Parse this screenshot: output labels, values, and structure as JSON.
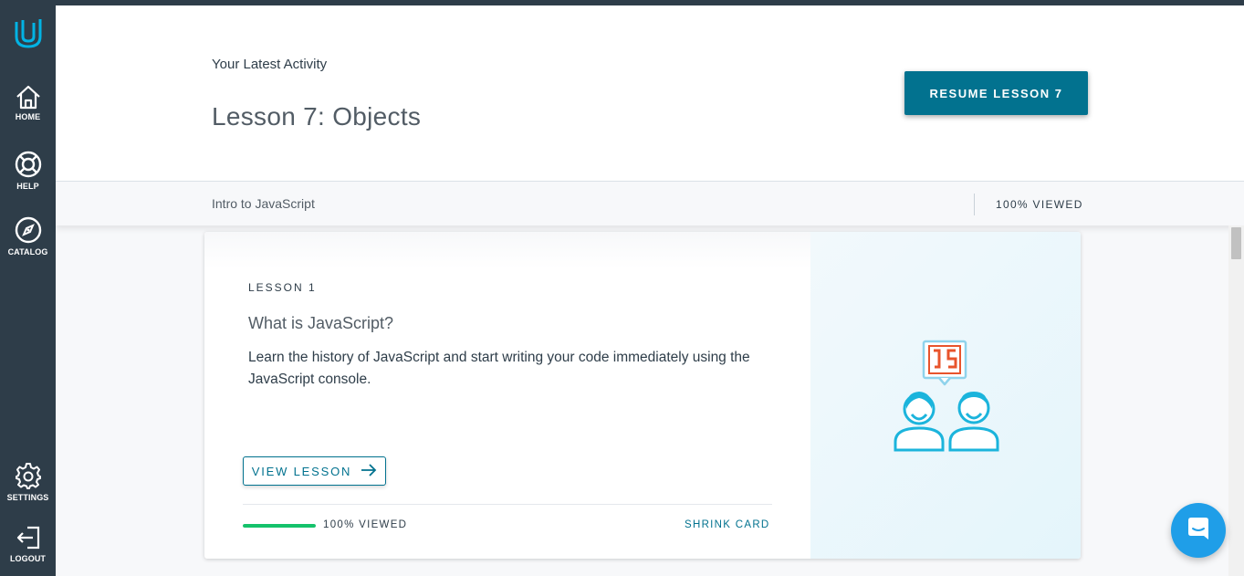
{
  "sidebar": {
    "logo": "udacity-logo-icon",
    "items": [
      {
        "label": "HOME",
        "icon": "home-icon"
      },
      {
        "label": "HELP",
        "icon": "lifebuoy-icon"
      },
      {
        "label": "CATALOG",
        "icon": "compass-icon"
      },
      {
        "label": "SETTINGS",
        "icon": "gear-icon"
      },
      {
        "label": "LOGOUT",
        "icon": "logout-icon"
      }
    ]
  },
  "header": {
    "activity_label": "Your Latest Activity",
    "lesson_title": "Lesson 7: Objects",
    "resume_button": "RESUME LESSON 7"
  },
  "subbar": {
    "course_name": "Intro to JavaScript",
    "viewed": "100% VIEWED"
  },
  "card": {
    "lesson_number": "LESSON 1",
    "title": "What is JavaScript?",
    "description": "Learn the history of JavaScript and start writing your code immediately using the JavaScript console.",
    "view_button": "VIEW LESSON",
    "progress_fraction": 1.0,
    "progress_label": "100% VIEWED",
    "shrink_link": "SHRINK CARD",
    "illustration": "javascript-people-illustration"
  },
  "colors": {
    "sidebar_bg": "#2e3d49",
    "accent": "#02728f",
    "logo": "#02b3e4",
    "progress": "#15c26b",
    "chat": "#1f9ee8",
    "js_badge": "#e8542c"
  },
  "chat": {
    "icon": "chat-icon"
  }
}
